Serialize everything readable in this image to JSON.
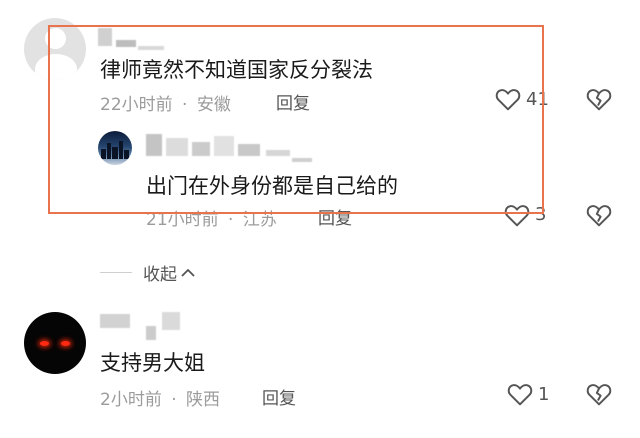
{
  "comments": [
    {
      "text": "律师竟然不知道国家反分裂法",
      "time": "22小时前",
      "location": "安徽",
      "reply_label": "回复",
      "likes": "41",
      "replies": [
        {
          "text": "出门在外身份都是自己给的",
          "time": "21小时前",
          "location": "江苏",
          "reply_label": "回复",
          "likes": "3"
        }
      ]
    },
    {
      "text": "支持男大姐",
      "time": "2小时前",
      "location": "陕西",
      "reply_label": "回复",
      "likes": "1"
    }
  ],
  "collapse_label": "收起",
  "separator": "·",
  "colors": {
    "highlight_border": "#e8734d",
    "meta": "#9b9b9b"
  },
  "icons": [
    "heart-outline-icon",
    "broken-heart-icon",
    "chevron-up-icon"
  ]
}
